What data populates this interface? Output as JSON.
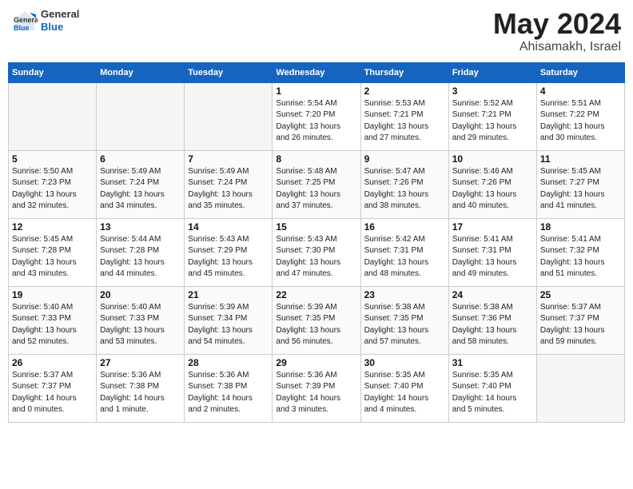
{
  "header": {
    "logo": {
      "general": "General",
      "blue": "Blue"
    },
    "title": "May 2024",
    "location": "Ahisamakh, Israel"
  },
  "calendar": {
    "days_of_week": [
      "Sunday",
      "Monday",
      "Tuesday",
      "Wednesday",
      "Thursday",
      "Friday",
      "Saturday"
    ],
    "weeks": [
      {
        "days": [
          {
            "num": "",
            "info": ""
          },
          {
            "num": "",
            "info": ""
          },
          {
            "num": "",
            "info": ""
          },
          {
            "num": "1",
            "info": "Sunrise: 5:54 AM\nSunset: 7:20 PM\nDaylight: 13 hours\nand 26 minutes."
          },
          {
            "num": "2",
            "info": "Sunrise: 5:53 AM\nSunset: 7:21 PM\nDaylight: 13 hours\nand 27 minutes."
          },
          {
            "num": "3",
            "info": "Sunrise: 5:52 AM\nSunset: 7:21 PM\nDaylight: 13 hours\nand 29 minutes."
          },
          {
            "num": "4",
            "info": "Sunrise: 5:51 AM\nSunset: 7:22 PM\nDaylight: 13 hours\nand 30 minutes."
          }
        ]
      },
      {
        "days": [
          {
            "num": "5",
            "info": "Sunrise: 5:50 AM\nSunset: 7:23 PM\nDaylight: 13 hours\nand 32 minutes."
          },
          {
            "num": "6",
            "info": "Sunrise: 5:49 AM\nSunset: 7:24 PM\nDaylight: 13 hours\nand 34 minutes."
          },
          {
            "num": "7",
            "info": "Sunrise: 5:49 AM\nSunset: 7:24 PM\nDaylight: 13 hours\nand 35 minutes."
          },
          {
            "num": "8",
            "info": "Sunrise: 5:48 AM\nSunset: 7:25 PM\nDaylight: 13 hours\nand 37 minutes."
          },
          {
            "num": "9",
            "info": "Sunrise: 5:47 AM\nSunset: 7:26 PM\nDaylight: 13 hours\nand 38 minutes."
          },
          {
            "num": "10",
            "info": "Sunrise: 5:46 AM\nSunset: 7:26 PM\nDaylight: 13 hours\nand 40 minutes."
          },
          {
            "num": "11",
            "info": "Sunrise: 5:45 AM\nSunset: 7:27 PM\nDaylight: 13 hours\nand 41 minutes."
          }
        ]
      },
      {
        "days": [
          {
            "num": "12",
            "info": "Sunrise: 5:45 AM\nSunset: 7:28 PM\nDaylight: 13 hours\nand 43 minutes."
          },
          {
            "num": "13",
            "info": "Sunrise: 5:44 AM\nSunset: 7:28 PM\nDaylight: 13 hours\nand 44 minutes."
          },
          {
            "num": "14",
            "info": "Sunrise: 5:43 AM\nSunset: 7:29 PM\nDaylight: 13 hours\nand 45 minutes."
          },
          {
            "num": "15",
            "info": "Sunrise: 5:43 AM\nSunset: 7:30 PM\nDaylight: 13 hours\nand 47 minutes."
          },
          {
            "num": "16",
            "info": "Sunrise: 5:42 AM\nSunset: 7:31 PM\nDaylight: 13 hours\nand 48 minutes."
          },
          {
            "num": "17",
            "info": "Sunrise: 5:41 AM\nSunset: 7:31 PM\nDaylight: 13 hours\nand 49 minutes."
          },
          {
            "num": "18",
            "info": "Sunrise: 5:41 AM\nSunset: 7:32 PM\nDaylight: 13 hours\nand 51 minutes."
          }
        ]
      },
      {
        "days": [
          {
            "num": "19",
            "info": "Sunrise: 5:40 AM\nSunset: 7:33 PM\nDaylight: 13 hours\nand 52 minutes."
          },
          {
            "num": "20",
            "info": "Sunrise: 5:40 AM\nSunset: 7:33 PM\nDaylight: 13 hours\nand 53 minutes."
          },
          {
            "num": "21",
            "info": "Sunrise: 5:39 AM\nSunset: 7:34 PM\nDaylight: 13 hours\nand 54 minutes."
          },
          {
            "num": "22",
            "info": "Sunrise: 5:39 AM\nSunset: 7:35 PM\nDaylight: 13 hours\nand 56 minutes."
          },
          {
            "num": "23",
            "info": "Sunrise: 5:38 AM\nSunset: 7:35 PM\nDaylight: 13 hours\nand 57 minutes."
          },
          {
            "num": "24",
            "info": "Sunrise: 5:38 AM\nSunset: 7:36 PM\nDaylight: 13 hours\nand 58 minutes."
          },
          {
            "num": "25",
            "info": "Sunrise: 5:37 AM\nSunset: 7:37 PM\nDaylight: 13 hours\nand 59 minutes."
          }
        ]
      },
      {
        "days": [
          {
            "num": "26",
            "info": "Sunrise: 5:37 AM\nSunset: 7:37 PM\nDaylight: 14 hours\nand 0 minutes."
          },
          {
            "num": "27",
            "info": "Sunrise: 5:36 AM\nSunset: 7:38 PM\nDaylight: 14 hours\nand 1 minute."
          },
          {
            "num": "28",
            "info": "Sunrise: 5:36 AM\nSunset: 7:38 PM\nDaylight: 14 hours\nand 2 minutes."
          },
          {
            "num": "29",
            "info": "Sunrise: 5:36 AM\nSunset: 7:39 PM\nDaylight: 14 hours\nand 3 minutes."
          },
          {
            "num": "30",
            "info": "Sunrise: 5:35 AM\nSunset: 7:40 PM\nDaylight: 14 hours\nand 4 minutes."
          },
          {
            "num": "31",
            "info": "Sunrise: 5:35 AM\nSunset: 7:40 PM\nDaylight: 14 hours\nand 5 minutes."
          },
          {
            "num": "",
            "info": ""
          }
        ]
      }
    ]
  }
}
